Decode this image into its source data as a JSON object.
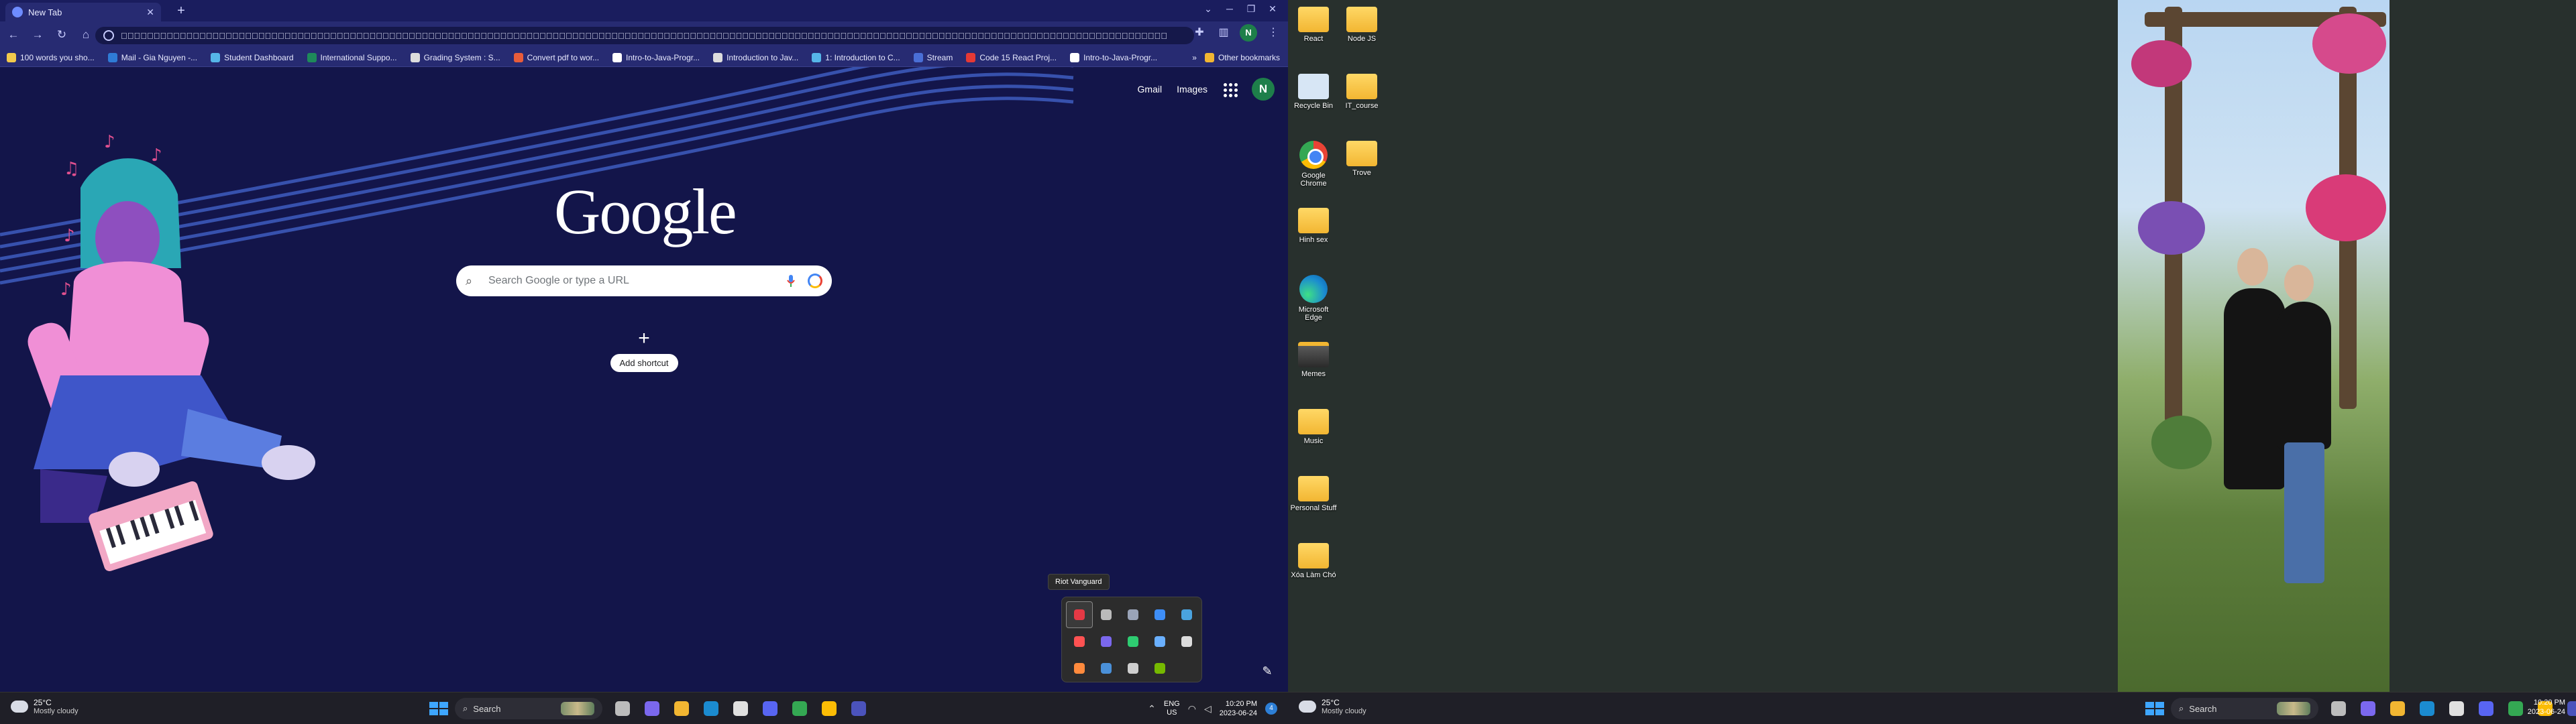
{
  "left_monitor": {
    "browser": {
      "tab": {
        "title": "New Tab"
      },
      "omnibox": {
        "value": "\u0000\u0000\u0000\u0000\u0000\u0000\u0000\u0000\u0000\u0000\u0000\u0000\u0000\u0000\u0000\u0000\u0000\u0000\u0000\u0000\u0000\u0000\u0000\u0000\u0000\u0000\u0000\u0000\u0000\u0000\u0000\u0000\u0000\u0000\u0000\u0000\u0000\u0000\u0000\u0000\u0000\u0000\u0000\u0000\u0000\u0000\u0000\u0000\u0000\u0000\u0000\u0000\u0000\u0000\u0000\u0000\u0000\u0000\u0000\u0000\u0000\u0000\u0000\u0000\u0000\u0000\u0000\u0000\u0000\u0000\u0000\u0000\u0000\u0000\u0000\u0000\u0000\u0000\u0000\u0000\u0000\u0000\u0000\u0000\u0000\u0000\u0000\u0000\u0000\u0000\u0000\u0000\u0000\u0000\u0000\u0000\u0000\u0000\u0000\u0000\u0000\u0000\u0000\u0000\u0000\u0000\u0000\u0000\u0000\u0000\u0000\u0000\u0000\u0000\u0000\u0000\u0000\u0000\u0000\u0000\u0000\u0000\u0000\u0000\u0000\u0000\u0000\u0000\u0000\u0000\u0000\u0000\u0000\u0000\u0000\u0000\u0000\u0000\u0000\u0000\u0000\u0000\u0000\u0000\u0000\u0000\u0000\u0000\u0000\u0000\u0000\u0000\u0000\u0000\u0000\u0000\u0000\u0000\u0000\u0000\u0000h"
      },
      "profile_initial": "N",
      "bookmarks": [
        {
          "label": "100 words you sho...",
          "color": "#f2c94c"
        },
        {
          "label": "Mail - Gia Nguyen -...",
          "color": "#2f7bd6"
        },
        {
          "label": "Student Dashboard",
          "color": "#56b6e8"
        },
        {
          "label": "International Suppo...",
          "color": "#1e8a5a"
        },
        {
          "label": "Grading System : S...",
          "color": "#dddddd"
        },
        {
          "label": "Convert pdf to wor...",
          "color": "#e85c3a"
        },
        {
          "label": "Intro-to-Java-Progr...",
          "color": "#ffffff"
        },
        {
          "label": "Introduction to Jav...",
          "color": "#dddddd"
        },
        {
          "label": "1: Introduction to C...",
          "color": "#56b6e8"
        },
        {
          "label": "Stream",
          "color": "#4a6fd6"
        },
        {
          "label": "Code 15 React Proj...",
          "color": "#e53935"
        },
        {
          "label": "Intro-to-Java-Progr...",
          "color": "#ffffff"
        }
      ],
      "bookmarks_more": "»",
      "other_bookmarks": "Other bookmarks",
      "ntp": {
        "gmail": "Gmail",
        "images": "Images",
        "logo": "Google",
        "search_placeholder": "Search Google or type a URL",
        "add_shortcut": "Add shortcut"
      }
    },
    "tray_tooltip": "Riot Vanguard",
    "tray_icons": [
      {
        "name": "riot-vanguard-icon",
        "color": "#e53945",
        "active": true
      },
      {
        "name": "controller-icon",
        "color": "#bbbbbb"
      },
      {
        "name": "steam-icon",
        "color": "#9aa4b8"
      },
      {
        "name": "bluetooth-icon",
        "color": "#3e8ef7"
      },
      {
        "name": "cloud-sync-icon",
        "color": "#4aa3df"
      },
      {
        "name": "security-icon",
        "color": "#ff5252"
      },
      {
        "name": "teams-icon",
        "color": "#7b68ee"
      },
      {
        "name": "xbox-icon",
        "color": "#2ecc71"
      },
      {
        "name": "steam-alt-icon",
        "color": "#6ab0ff"
      },
      {
        "name": "mouse-icon",
        "color": "#dddddd"
      },
      {
        "name": "orange-app-icon",
        "color": "#ff8a3d"
      },
      {
        "name": "blue-app-icon",
        "color": "#4a90d9"
      },
      {
        "name": "clock-app-icon",
        "color": "#cfcfcf"
      },
      {
        "name": "nvidia-icon",
        "color": "#76b900"
      }
    ],
    "taskbar": {
      "weather_temp": "25°C",
      "weather_desc": "Mostly cloudy",
      "search_label": "Search",
      "apps": [
        {
          "name": "task-view-icon",
          "color": "#bcbcbc"
        },
        {
          "name": "teams-chat-icon",
          "color": "#7b68ee"
        },
        {
          "name": "file-explorer-icon",
          "color": "#f2b632"
        },
        {
          "name": "edge-icon",
          "color": "#1b8bd0"
        },
        {
          "name": "store-icon",
          "color": "#e0e0e0"
        },
        {
          "name": "discord-icon",
          "color": "#5865f2"
        },
        {
          "name": "chrome-icon",
          "color": "#34a853"
        },
        {
          "name": "chrome-profile-icon",
          "color": "#fbbc05"
        },
        {
          "name": "teams-icon",
          "color": "#4b53bc"
        }
      ],
      "lang_top": "ENG",
      "lang_bottom": "US",
      "time": "10:20 PM",
      "date": "2023-06-24",
      "notif_count": "4"
    }
  },
  "right_monitor": {
    "desktop_icons": [
      {
        "label": "React",
        "kind": "folder"
      },
      {
        "label": "Node JS",
        "kind": "folder"
      },
      {
        "label": "Recycle Bin",
        "kind": "bin"
      },
      {
        "label": "IT_course",
        "kind": "folder"
      },
      {
        "label": "Google Chrome",
        "kind": "chrome"
      },
      {
        "label": "Trove",
        "kind": "folder"
      },
      {
        "label": "Hinh sex",
        "kind": "folder"
      },
      {
        "label": "Microsoft Edge",
        "kind": "edge"
      },
      {
        "label": "Memes",
        "kind": "folder-dark"
      },
      {
        "label": "Music",
        "kind": "folder"
      },
      {
        "label": "Personal Stuff",
        "kind": "folder"
      },
      {
        "label": "Xóa Làm Chó",
        "kind": "folder"
      }
    ],
    "taskbar": {
      "weather_temp": "25°C",
      "weather_desc": "Mostly cloudy",
      "search_label": "Search",
      "time": "10:20 PM",
      "date": "2023-06-24"
    }
  }
}
